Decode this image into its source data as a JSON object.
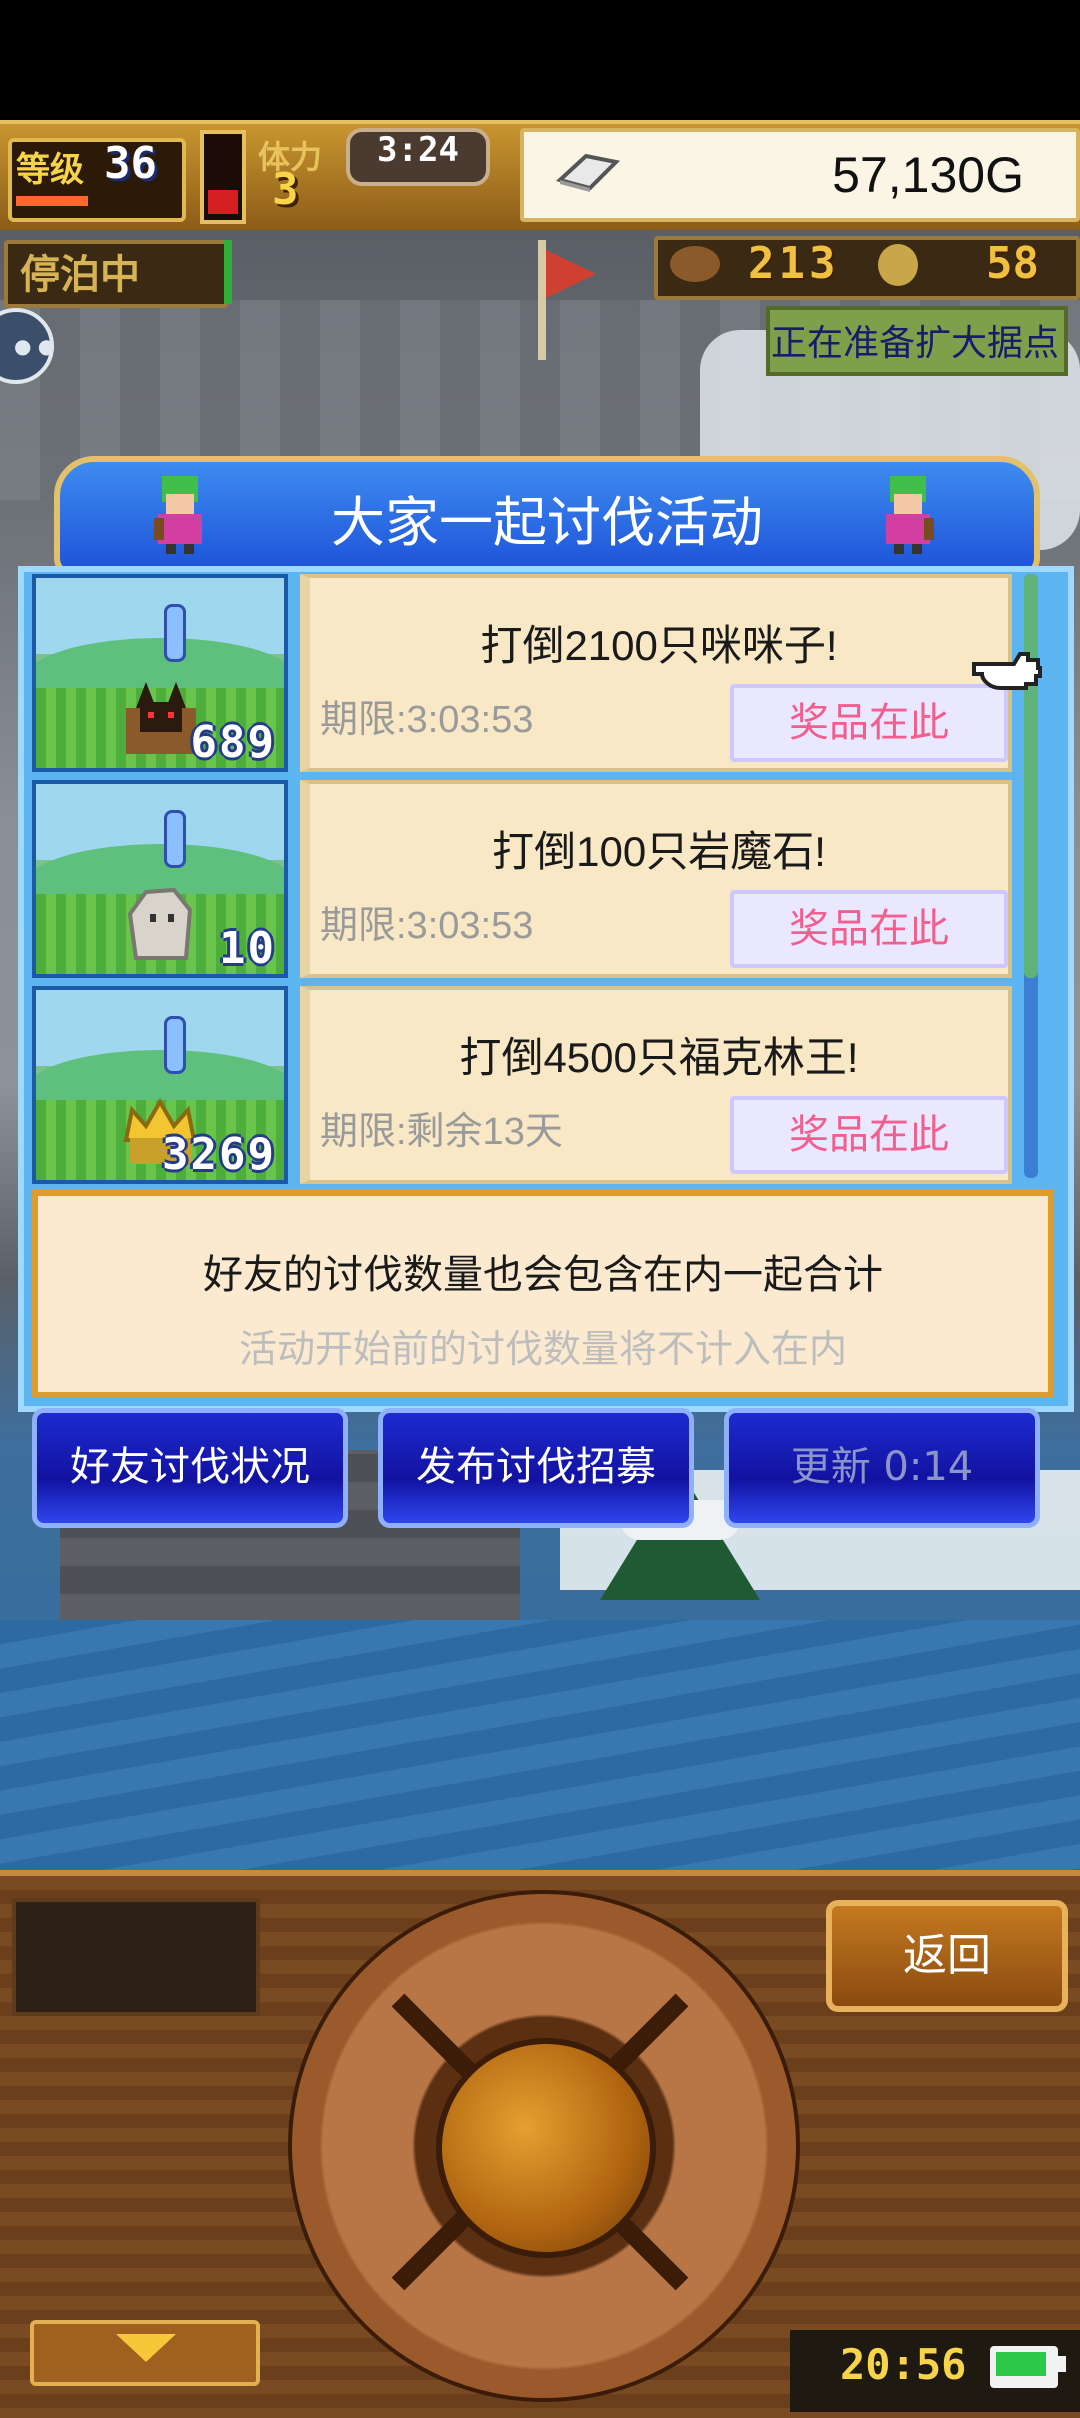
{
  "hud": {
    "level_label": "等级",
    "level_value": "36",
    "stamina_label": "体力",
    "stamina_value": "3",
    "timer": "3:24",
    "gold": "57,130G",
    "moored_label": "停泊中",
    "resource1": "213",
    "resource2": "58",
    "status_banner": "正在准备扩大据点"
  },
  "dialog": {
    "title": "大家一起讨伐活动",
    "quests": [
      {
        "kill_count": "689",
        "title": "打倒2100只咪咪子!",
        "deadline": "期限:3:03:53",
        "prize_label": "奖品在此",
        "monster": "cat-monster-icon"
      },
      {
        "kill_count": "10",
        "title": "打倒100只岩魔石!",
        "deadline": "期限:3:03:53",
        "prize_label": "奖品在此",
        "monster": "rock-monster-icon"
      },
      {
        "kill_count": "3269",
        "title": "打倒4500只福克林王!",
        "deadline": "期限:剩余13天",
        "prize_label": "奖品在此",
        "monster": "crown-monster-icon"
      }
    ],
    "note_main": "好友的讨伐数量也会包含在内一起合计",
    "note_sub": "活动开始前的讨伐数量将不计入在内",
    "buttons": {
      "friend_status": "好友讨伐状况",
      "post_recruit": "发布讨伐招募",
      "refresh": "更新 0:14"
    }
  },
  "controls": {
    "back_label": "返回",
    "clock": "20:56"
  },
  "colors": {
    "dialog_blue": "#1d52d8",
    "prize_pink": "#f25f8e",
    "gold_text": "#f7d44a"
  }
}
